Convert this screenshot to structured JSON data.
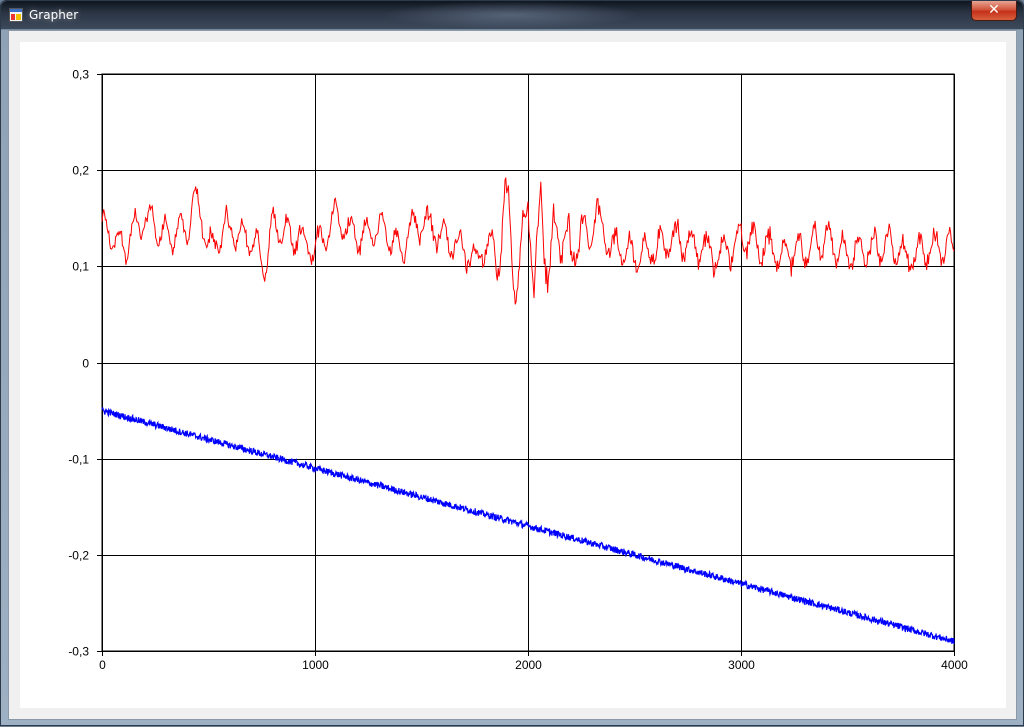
{
  "window": {
    "title": "Grapher",
    "close_label": "✕"
  },
  "icons": {
    "app": "app-window-icon",
    "close": "close-icon"
  },
  "chart_data": {
    "type": "line",
    "title": "",
    "xlabel": "",
    "ylabel": "",
    "xlim": [
      0,
      4000
    ],
    "ylim": [
      -0.3,
      0.3
    ],
    "grid": true,
    "x_ticks": [
      0,
      1000,
      2000,
      3000,
      4000
    ],
    "x_tick_labels": [
      "0",
      "1000",
      "2000",
      "3000",
      "4000"
    ],
    "y_ticks": [
      0.3,
      0.2,
      0.1,
      0,
      -0.1,
      -0.2,
      -0.3
    ],
    "y_tick_labels": [
      "0,3",
      "0,2",
      "0,1",
      "0",
      "-0,1",
      "-0,2",
      "-0,3"
    ],
    "series": [
      {
        "color": "#ff0000",
        "description": "noisy signal around 0.13 with burst near x=2000",
        "x": [
          0,
          100,
          200,
          300,
          400,
          450,
          500,
          600,
          700,
          770,
          800,
          900,
          1000,
          1100,
          1200,
          1300,
          1400,
          1500,
          1600,
          1700,
          1750,
          1800,
          1850,
          1900,
          1950,
          1990,
          2000,
          2030,
          2060,
          2100,
          2150,
          2200,
          2250,
          2300,
          2320,
          2400,
          2500,
          2600,
          2700,
          2800,
          2900,
          3000,
          3100,
          3200,
          3300,
          3400,
          3500,
          3600,
          3700,
          3800,
          3900,
          4000
        ],
        "values": [
          0.14,
          0.12,
          0.15,
          0.13,
          0.14,
          0.17,
          0.12,
          0.14,
          0.13,
          0.1,
          0.14,
          0.13,
          0.12,
          0.15,
          0.13,
          0.14,
          0.12,
          0.15,
          0.13,
          0.12,
          0.1,
          0.13,
          0.11,
          0.16,
          0.08,
          0.14,
          0.19,
          0.07,
          0.16,
          0.1,
          0.15,
          0.1,
          0.14,
          0.13,
          0.15,
          0.12,
          0.11,
          0.12,
          0.13,
          0.12,
          0.11,
          0.13,
          0.12,
          0.11,
          0.12,
          0.13,
          0.11,
          0.12,
          0.12,
          0.11,
          0.12,
          0.12
        ]
      },
      {
        "color": "#0000ff",
        "description": "linear downward trend with small noise",
        "x": [
          0,
          500,
          1000,
          1500,
          2000,
          2500,
          3000,
          3500,
          4000
        ],
        "values": [
          -0.05,
          -0.08,
          -0.11,
          -0.14,
          -0.17,
          -0.2,
          -0.23,
          -0.26,
          -0.29
        ]
      }
    ]
  }
}
